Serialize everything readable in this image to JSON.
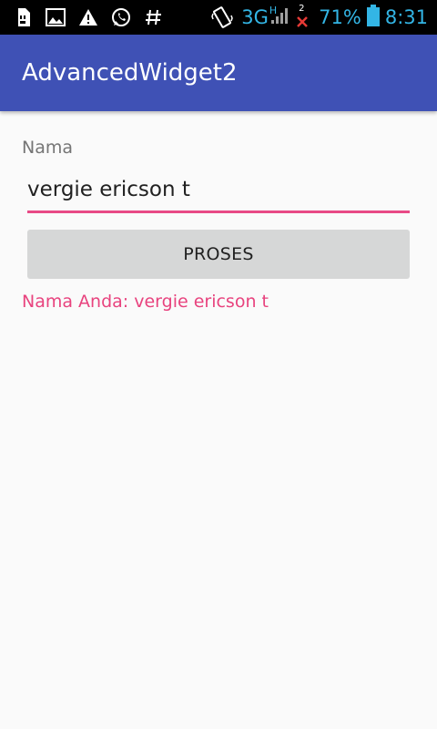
{
  "status_bar": {
    "icons": [
      "sim-card-icon",
      "image-icon",
      "warning-icon",
      "whatsapp-icon",
      "hash-icon",
      "vibrate-icon",
      "signal-icon",
      "no-signal-icon",
      "battery-icon"
    ],
    "network": "3G",
    "network_sub": "H",
    "sim2_label": "2",
    "battery_percent": "71%",
    "time": "8:31",
    "accent_color": "#33b5e5"
  },
  "app_bar": {
    "title": "AdvancedWidget2",
    "color": "#3f51b5"
  },
  "form": {
    "label": "Nama",
    "input_value": "vergie ericson t",
    "accent_color": "#e84a86"
  },
  "button": {
    "label": "PROSES"
  },
  "result": {
    "text": "Nama Anda: vergie ericson t"
  }
}
